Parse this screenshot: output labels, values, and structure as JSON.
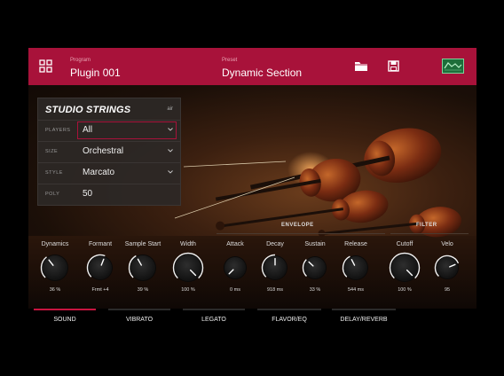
{
  "header": {
    "program_label": "Program",
    "program_name": "Plugin 001",
    "preset_label": "Preset",
    "preset_name": "Dynamic Section",
    "accent": "#a8123a"
  },
  "panel": {
    "brand": "STUDIO STRINGS",
    "brand_sub": "air",
    "rows": [
      {
        "label": "PLAYERS",
        "value": "All",
        "dropdown": true
      },
      {
        "label": "SIZE",
        "value": "Orchestral",
        "dropdown": true
      },
      {
        "label": "STYLE",
        "value": "Marcato",
        "dropdown": true
      },
      {
        "label": "POLY",
        "value": "50",
        "dropdown": false
      }
    ]
  },
  "sections": {
    "envelope": "ENVELOPE",
    "filter": "FILTER"
  },
  "knobs": [
    {
      "label": "Dynamics",
      "value": "36 %",
      "level": 0.36
    },
    {
      "label": "Formant",
      "value": "Frmt +4",
      "level": 0.58
    },
    {
      "label": "Sample Start",
      "value": "39 %",
      "level": 0.39
    },
    {
      "label": "Width",
      "value": "100 %",
      "level": 1.0
    },
    {
      "label": "Attack",
      "value": "0 ms",
      "level": 0.0
    },
    {
      "label": "Decay",
      "value": "918 ms",
      "level": 0.5
    },
    {
      "label": "Sustain",
      "value": "33 %",
      "level": 0.33
    },
    {
      "label": "Release",
      "value": "544 ms",
      "level": 0.4
    },
    {
      "label": "Cutoff",
      "value": "100 %",
      "level": 1.0
    },
    {
      "label": "Velo",
      "value": "95",
      "level": 0.75
    }
  ],
  "tabs": [
    {
      "label": "SOUND",
      "active": true
    },
    {
      "label": "VIBRATO",
      "active": false
    },
    {
      "label": "LEGATO",
      "active": false
    },
    {
      "label": "FLAVOR/EQ",
      "active": false
    },
    {
      "label": "DELAY/REVERB",
      "active": false
    }
  ],
  "icons": [
    "grid-icon",
    "folder-icon",
    "save-icon",
    "waveform-view-icon"
  ]
}
